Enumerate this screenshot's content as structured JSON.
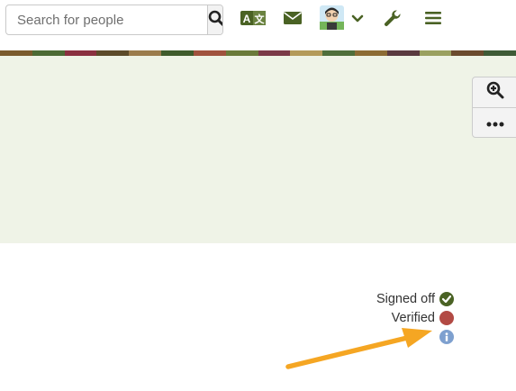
{
  "search": {
    "placeholder": "Search for people"
  },
  "nav": {
    "icons": [
      "translate-icon",
      "envelope-icon",
      "avatar",
      "chevron-down-icon",
      "wrench-icon",
      "hamburger-icon"
    ],
    "accent_color": "#4a6224"
  },
  "banner": {
    "background": "#eff3e7",
    "stripe_colors": [
      "#7a5a2d",
      "#4c6a35",
      "#8a3040",
      "#5c4a2a",
      "#9b7b4c",
      "#3f5b2c",
      "#a0523e",
      "#6a7a3a",
      "#7b3a48",
      "#b49a5a",
      "#4f6e3b",
      "#8c6b34",
      "#5a3a40",
      "#9aa060",
      "#6b4a2e",
      "#3e5a36"
    ]
  },
  "side_tools": {
    "items": [
      "zoom-in-icon",
      "more-options-icon"
    ]
  },
  "status": {
    "signed_off_label": "Signed off",
    "signed_off_color": "#4a6224",
    "verified_label": "Verified",
    "verified_color": "#b24a44",
    "info_color": "#7ea0cf"
  },
  "annotation": {
    "arrow_color": "#f5a623"
  }
}
